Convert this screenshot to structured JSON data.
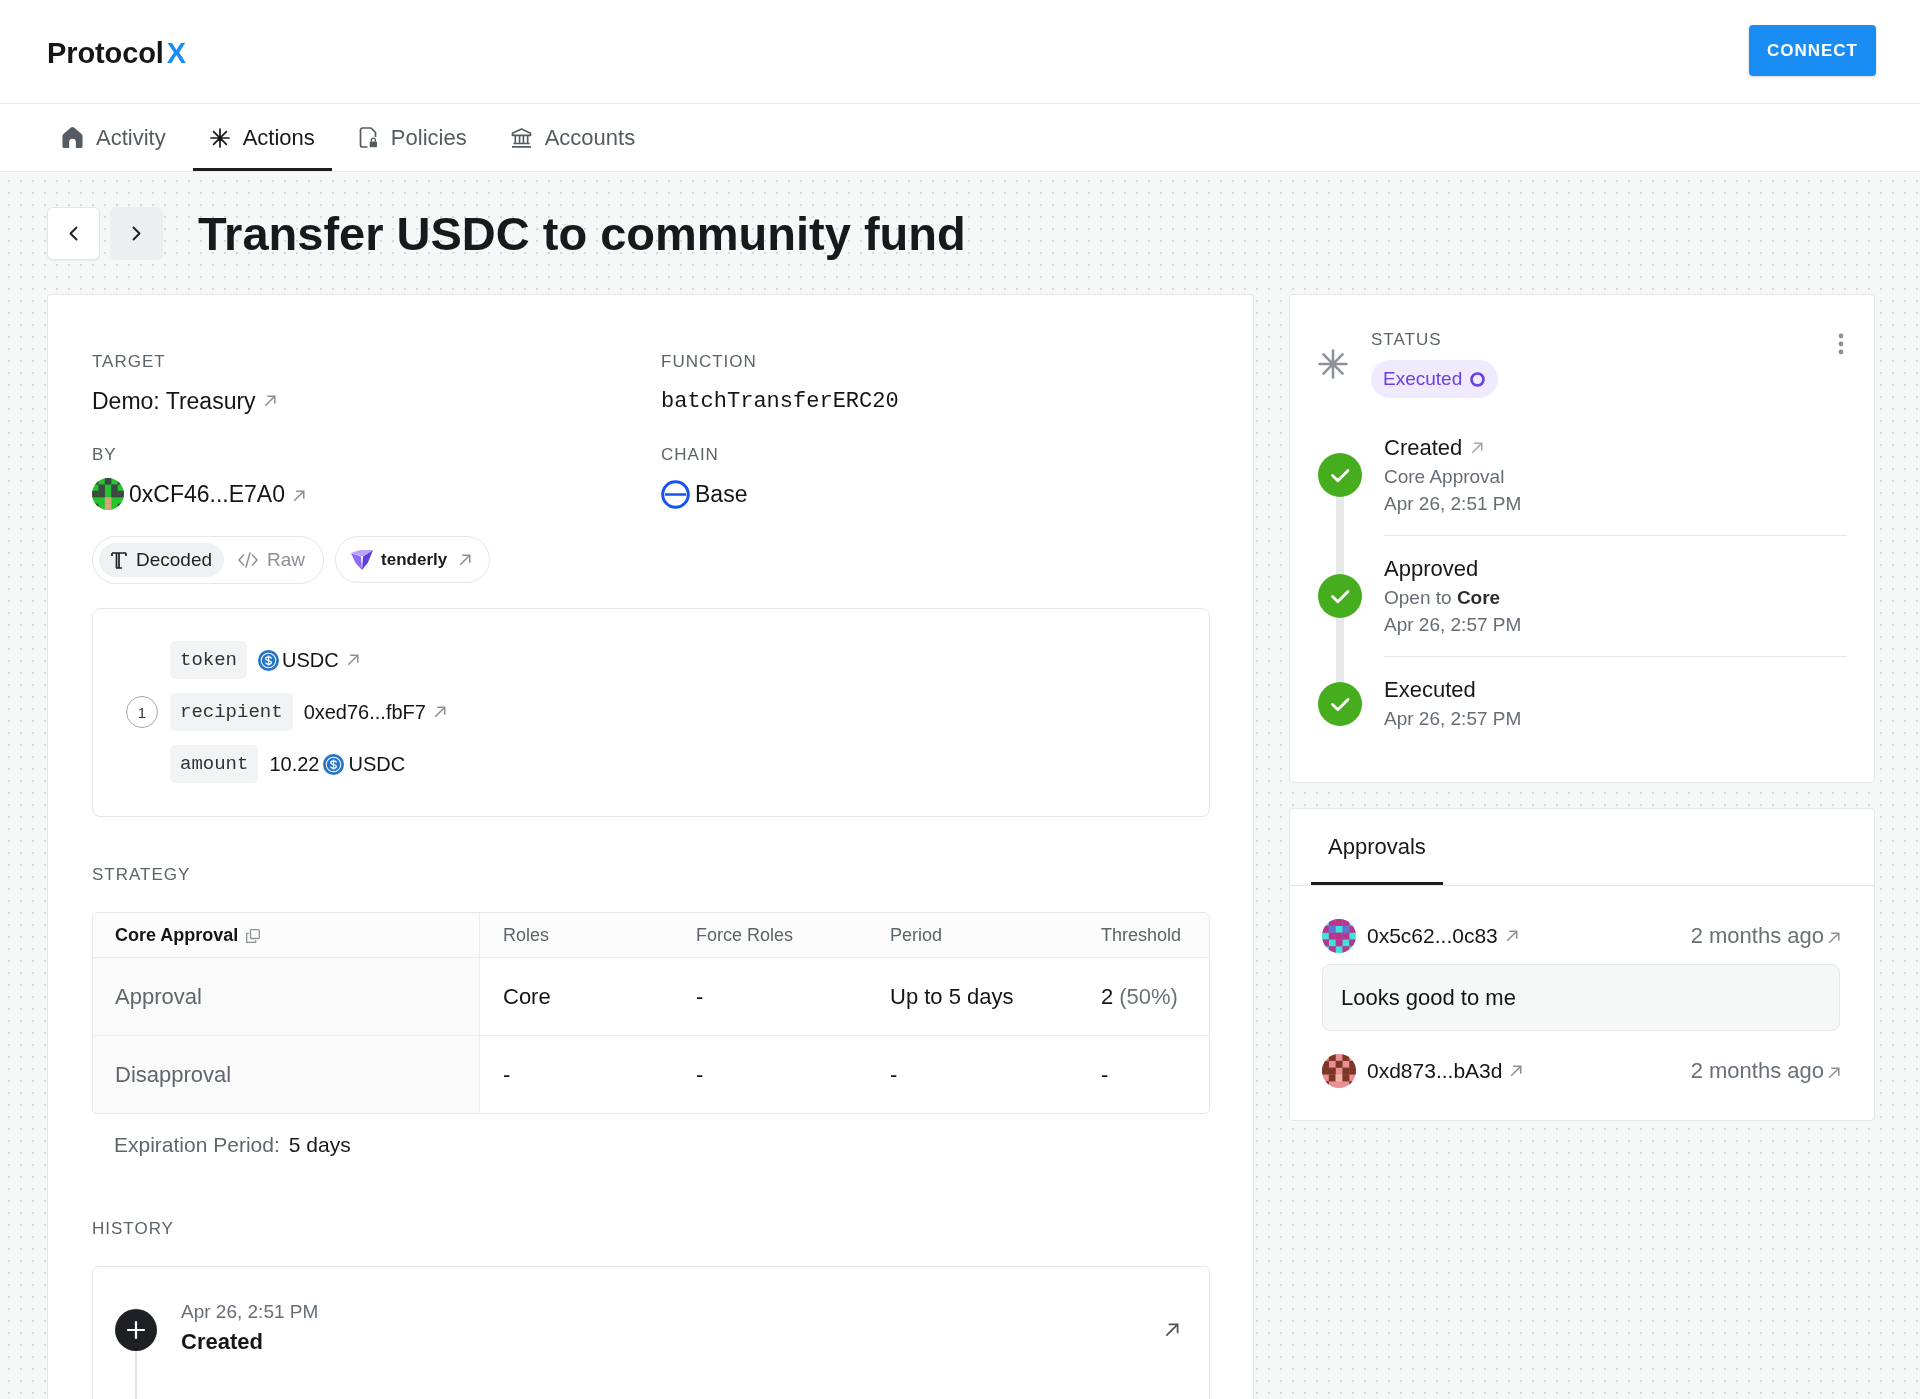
{
  "header": {
    "logo": {
      "text": "Protocol",
      "accent": "X"
    },
    "connect_button": "CONNECT"
  },
  "tabs": [
    {
      "label": "Activity",
      "selected": false
    },
    {
      "label": "Actions",
      "selected": true
    },
    {
      "label": "Policies",
      "selected": false
    },
    {
      "label": "Accounts",
      "selected": false
    }
  ],
  "pager": [
    {
      "kind": "previous",
      "hovered": false
    },
    {
      "kind": "next",
      "hovered": true
    }
  ],
  "title": "Transfer USDC to community fund",
  "details": [
    {
      "label": "TARGET",
      "kind": "link",
      "value": "Demo: Treasury"
    },
    {
      "label": "FUNCTION",
      "kind": "code",
      "value": "batchTransferERC20"
    },
    {
      "label": "BY",
      "kind": "account",
      "value": "0xCF46...E7A0"
    },
    {
      "label": "CHAIN",
      "kind": "chain",
      "value": "Base"
    }
  ],
  "view_modes": [
    {
      "label": "Decoded",
      "selected": true
    },
    {
      "label": "Raw",
      "selected": false
    }
  ],
  "simulation_link": "tenderly",
  "calls": [
    {
      "number": "1",
      "params": [
        {
          "name": "token",
          "kind": "token",
          "value": "USDC"
        },
        {
          "name": "recipient",
          "kind": "address",
          "value": "0xed76...fbF7"
        },
        {
          "name": "amount",
          "kind": "amount",
          "value": "10.22",
          "token": "USDC"
        }
      ]
    }
  ],
  "strategy": {
    "label": "STRATEGY",
    "name": "Core Approval",
    "columns": [
      "Roles",
      "Force Roles",
      "Period",
      "Threshold"
    ],
    "rows": [
      {
        "label": "Approval",
        "cells": [
          {
            "text": "Core"
          },
          {
            "text": "-"
          },
          {
            "text": "Up to 5 days"
          },
          {
            "text": "2",
            "note": "(50%)"
          }
        ]
      },
      {
        "label": "Disapproval",
        "cells": [
          {
            "text": "-"
          },
          {
            "text": "-"
          },
          {
            "text": "-"
          },
          {
            "text": "-"
          }
        ]
      }
    ],
    "expiration": {
      "label": "Expiration Period:",
      "value": "5 days"
    }
  },
  "history": {
    "label": "HISTORY",
    "events": [
      {
        "date": "Apr 26, 2:51 PM",
        "title": "Created"
      }
    ]
  },
  "status": {
    "label": "STATUS",
    "badge": "Executed",
    "steps": [
      {
        "title": "Created",
        "link": true,
        "detail": "Core Approval",
        "date": "Apr 26, 2:51 PM",
        "done": true
      },
      {
        "title": "Approved",
        "link": false,
        "detail": "Open to **Core**",
        "date": "Apr 26, 2:57 PM",
        "done": true
      },
      {
        "title": "Executed",
        "link": false,
        "date": "Apr 26, 2:57 PM",
        "done": true
      }
    ]
  },
  "approvals": {
    "tabs": [
      {
        "label": "Approvals",
        "selected": true
      }
    ],
    "items": [
      {
        "address": "0x5c62...0c83",
        "time": "2 months ago",
        "comment": "Looks good to me"
      },
      {
        "address": "0xd873...bA3d",
        "time": "2 months ago"
      }
    ]
  }
}
